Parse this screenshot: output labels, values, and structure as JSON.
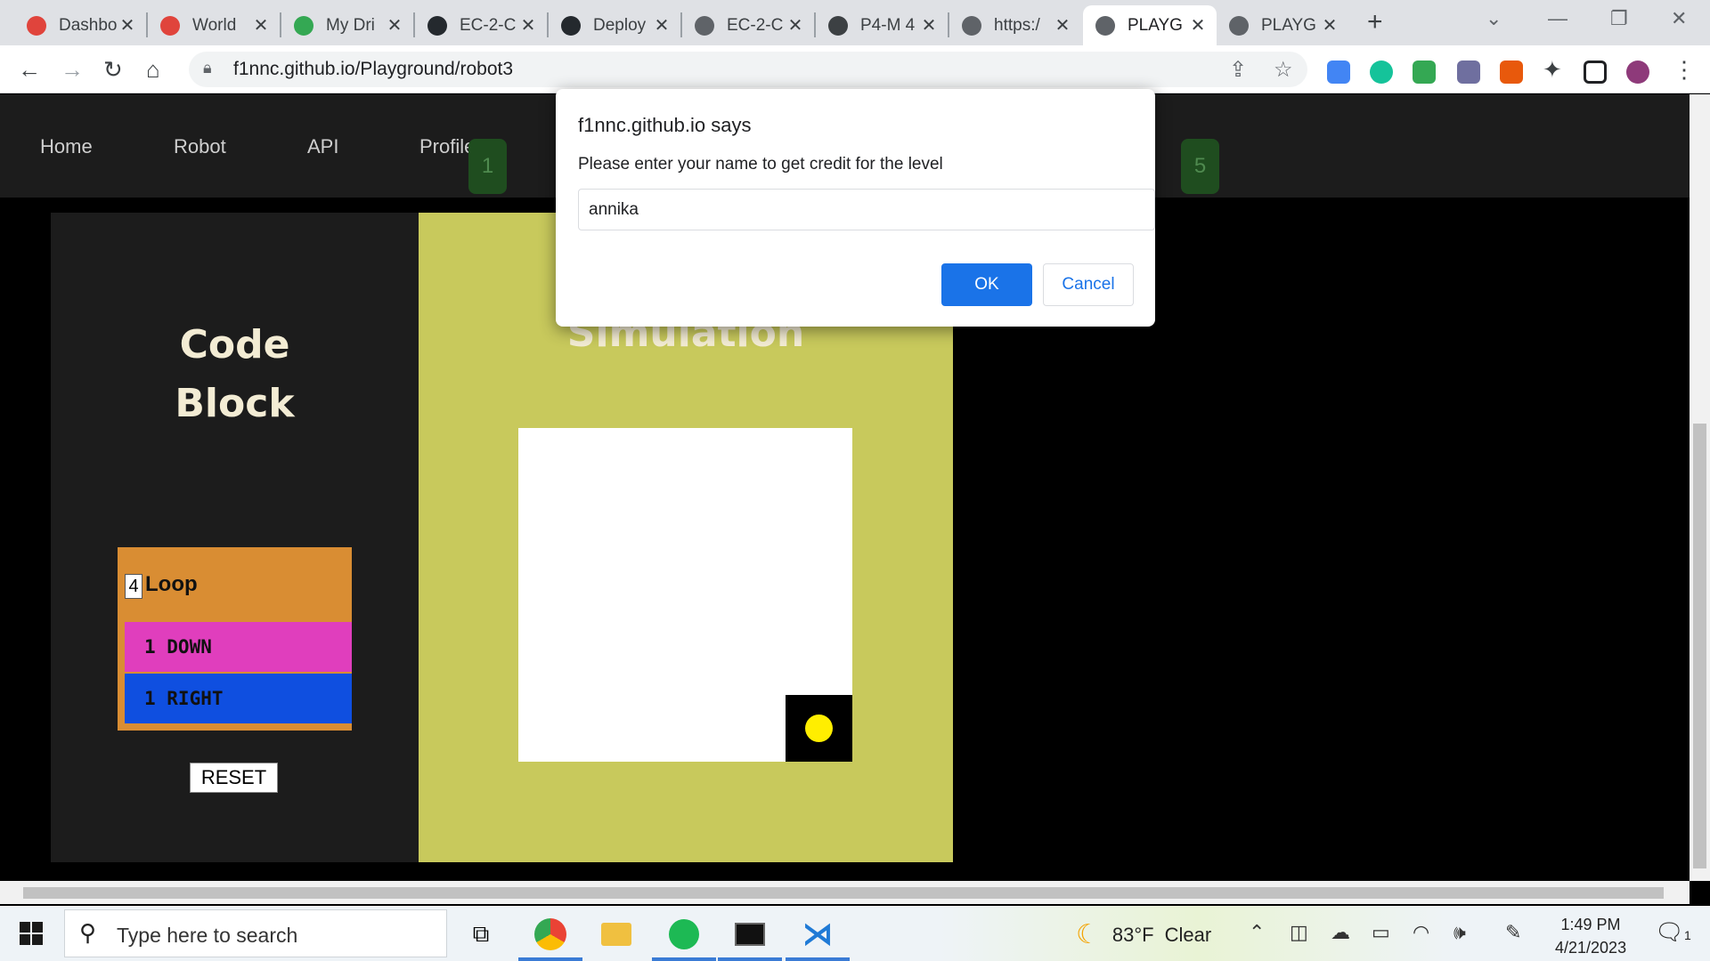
{
  "browser": {
    "tabs": [
      {
        "title": "Dashbo",
        "icon": "canvas-icon",
        "color": "#e0443c"
      },
      {
        "title": "World",
        "icon": "canvas-icon",
        "color": "#e0443c"
      },
      {
        "title": "My Dri",
        "icon": "google-drive-icon",
        "color": "#34a853"
      },
      {
        "title": "EC-2-C",
        "icon": "github-icon",
        "color": "#24292e"
      },
      {
        "title": "Deploy",
        "icon": "github-icon",
        "color": "#24292e"
      },
      {
        "title": "EC-2-C",
        "icon": "globe-icon",
        "color": "#5f6368"
      },
      {
        "title": "P4-M 4",
        "icon": "tool-icon",
        "color": "#3c4043"
      },
      {
        "title": "https:/",
        "icon": "globe-icon",
        "color": "#5f6368"
      },
      {
        "title": "PLAYG",
        "icon": "globe-icon",
        "color": "#5f6368",
        "active": true
      },
      {
        "title": "PLAYG",
        "icon": "globe-icon",
        "color": "#5f6368"
      }
    ],
    "url": "f1nnc.github.io/Playground/robot3"
  },
  "site": {
    "nav": [
      "Home",
      "Robot",
      "API",
      "Profile"
    ],
    "levels": [
      "1",
      "5"
    ],
    "code_title_line1": "Code",
    "code_title_line2": "Block",
    "loop_count": "4",
    "loop_label": "Loop",
    "commands": [
      {
        "label": "1 DOWN",
        "color": "#e03ebd"
      },
      {
        "label": "1 RIGHT",
        "color": "#0f4fe0"
      }
    ],
    "reset_label": "RESET",
    "sim_title": "Simulation"
  },
  "dialog": {
    "title": "f1nnc.github.io says",
    "message": "Please enter your name to get credit for the level",
    "input_value": "annika",
    "ok_label": "OK",
    "cancel_label": "Cancel"
  },
  "taskbar": {
    "search_placeholder": "Type here to search",
    "weather_temp": "83°F",
    "weather_desc": "Clear",
    "time": "1:49 PM",
    "date": "4/21/2023",
    "notification_count": "1"
  }
}
